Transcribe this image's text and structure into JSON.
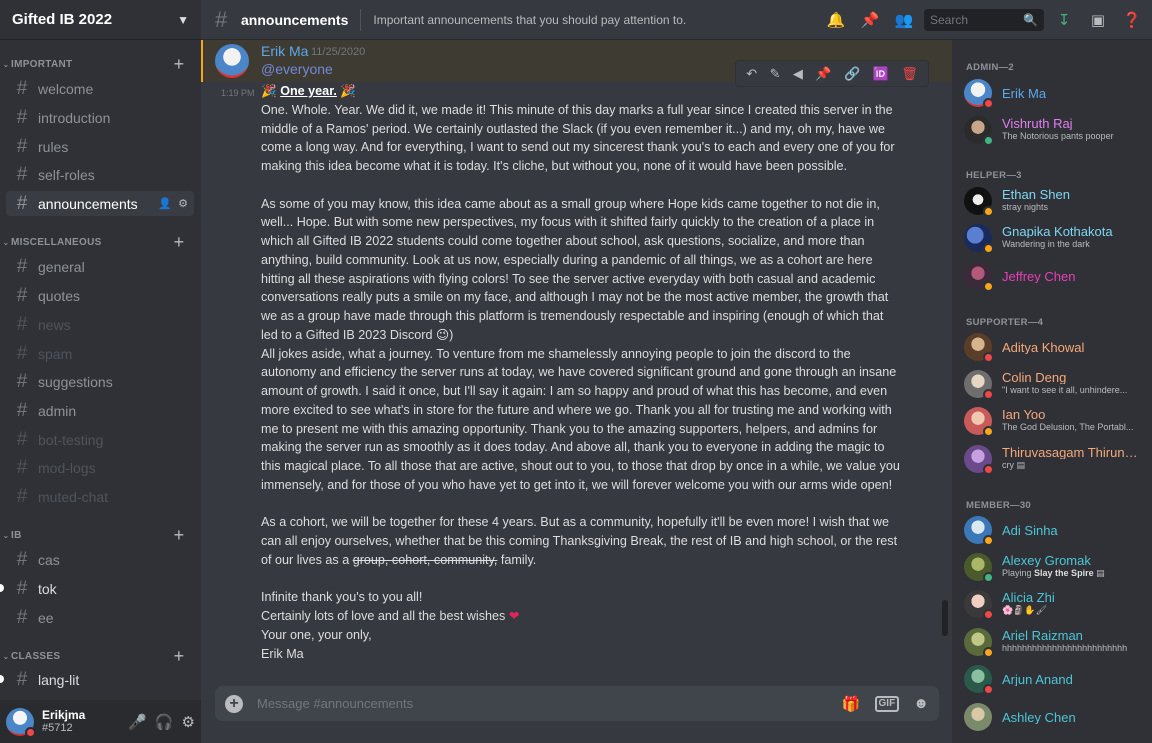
{
  "server": {
    "name": "Gifted IB 2022"
  },
  "colors": {
    "background": "#36393f",
    "sidebar": "#2f3136",
    "accent": "#7289da",
    "mention_highlight": "#faa61a",
    "danger": "#f04747"
  },
  "categories": {
    "important": "IMPORTANT",
    "miscellaneous": "MISCELLANEOUS",
    "ib": "IB",
    "classes": "CLASSES"
  },
  "channels": {
    "welcome": "welcome",
    "introduction": "introduction",
    "rules": "rules",
    "self_roles": "self-roles",
    "announcements": "announcements",
    "general": "general",
    "quotes": "quotes",
    "news": "news",
    "spam": "spam",
    "suggestions": "suggestions",
    "admin": "admin",
    "bot_testing": "bot-testing",
    "mod_logs": "mod-logs",
    "muted_chat": "muted-chat",
    "cas": "cas",
    "tok": "tok",
    "ee": "ee",
    "lang_lit": "lang-lit"
  },
  "user": {
    "name": "Erikjma",
    "tag": "#5712"
  },
  "topbar": {
    "channel": "announcements",
    "topic": "Important announcements that you should pay attention to.",
    "search_placeholder": "Search"
  },
  "message": {
    "author": "Erik Ma",
    "date": "11/25/2020",
    "mention": "@everyone",
    "time": "1:19 PM",
    "heading": "One year.",
    "p1": "One. Whole. Year. We did it, we made it! This minute of this day marks a full year since I created this server in the middle of a Ramos' period. We certainly outlasted the Slack (if you even remember it...) and my, oh my, have we come a long way. And for everything, I want to send out my sincerest thank you's to each and every one of you for making this idea become what it is today. It's cliche, but without you, none of it would have been possible.",
    "p2": "As some of you may know, this idea came about as a small group where Hope kids came together to not die in, well... Hope. But with some new perspectives, my focus with it shifted fairly quickly to the creation of a place in which all Gifted IB 2022 students could come together about school, ask questions, socialize, and more than anything, build community. Look at us now, especially during a pandemic of all things, we as a cohort are here hitting all these aspirations with flying colors! To see the server active everyday with both casual and academic conversations really puts a smile on my face, and although I may not be the most active member, the growth that we as a group have made through this platform is tremendously respectable and inspiring (enough of which that led to a Gifted IB 2023 Discord",
    "p3": "All jokes aside, what a journey. To venture from me shamelessly annoying people to join the discord to the autonomy and efficiency the server runs at today, we have covered significant ground and gone through an insane amount of growth. I said it once, but I'll say it again: I am so happy and proud of what this has become, and even more excited to see what's in store for the future and where we go. Thank you all for trusting me and working with me to present me with this amazing opportunity. Thank you to the amazing supporters, helpers, and admins for making the server run as smoothly as it does today. And above all, thank you to everyone in adding the magic to this magical place. To all those that are active, shout out to you, to those that drop by once in a while, we value you immensely, and for those of you who have yet to get into it, we will forever welcome you with our arms wide open!",
    "p4a": "As a cohort, we will be together for these 4 years. But as a community, hopefully it'll be even more! I wish that we can all enjoy ourselves, whether that be this coming Thanksgiving Break, the rest of IB and high school, or the rest of our lives as a",
    "p4strike": "group, cohort, community,",
    "p4b": "family.",
    "l1": "Infinite thank you's to you all!",
    "l2": "Certainly lots of love and all the best wishes",
    "l3": "Your one, your only,",
    "l4": "Erik Ma"
  },
  "composer": {
    "placeholder": "Message #announcements",
    "gif_label": "GIF"
  },
  "members": {
    "admin_head": "ADMIN—2",
    "helper_head": "HELPER—3",
    "supporter_head": "SUPPORTER—4",
    "member_head": "MEMBER—30",
    "erik": {
      "name": "Erik Ma"
    },
    "vishruth": {
      "name": "Vishruth Raj",
      "status": "The Notorious pants pooper"
    },
    "ethan": {
      "name": "Ethan Shen",
      "status": "stray nights"
    },
    "gnapika": {
      "name": "Gnapika Kothakota",
      "status": "Wandering in the dark"
    },
    "jeffrey": {
      "name": "Jeffrey Chen"
    },
    "aditya": {
      "name": "Aditya Khowal"
    },
    "colin": {
      "name": "Colin Deng",
      "status": "\"I want to see it all, unhindere..."
    },
    "ian": {
      "name": "Ian Yoo",
      "status": "The God Delusion, The Portabl..."
    },
    "thiru": {
      "name": "Thiruvasagam Thiruna...",
      "status": "cry"
    },
    "adi": {
      "name": "Adi Sinha"
    },
    "alexey": {
      "name": "Alexey Gromak",
      "status_prefix": "Playing",
      "status_game": "Slay the Spire"
    },
    "alicia": {
      "name": "Alicia Zhi"
    },
    "ariel": {
      "name": "Ariel Raizman",
      "status": "hhhhhhhhhhhhhhhhhhhhhhhhh"
    },
    "arjun": {
      "name": "Arjun Anand"
    },
    "ashley": {
      "name": "Ashley Chen"
    }
  }
}
